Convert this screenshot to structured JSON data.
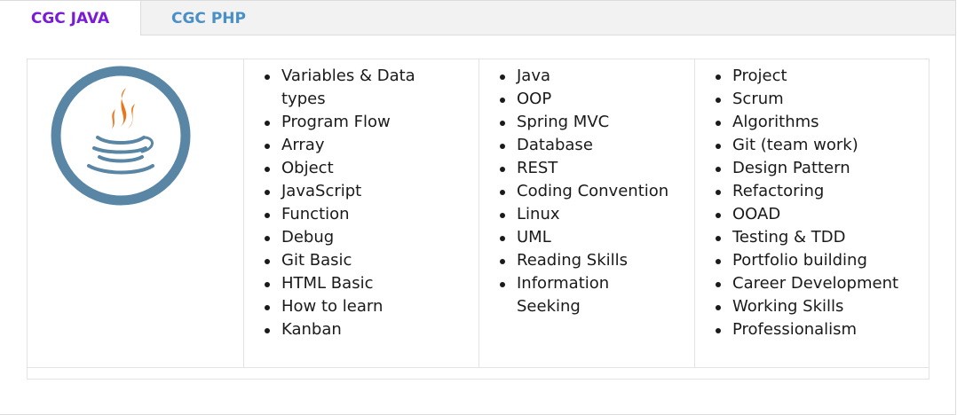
{
  "tabs": [
    {
      "label": "CGC JAVA",
      "active": true,
      "color": "#7a1bd6"
    },
    {
      "label": "CGC PHP",
      "active": false,
      "color": "#4a90c6"
    }
  ],
  "logo": {
    "icon": "java-logo-icon",
    "ring_color": "#5a86a6",
    "flame_color": "#e8761b",
    "cup_color": "#5a86a6"
  },
  "columns": [
    {
      "items": [
        "Variables & Data types",
        "Program Flow",
        "Array",
        "Object",
        "JavaScript",
        "Function",
        "Debug",
        "Git Basic",
        "HTML Basic",
        "How to learn",
        "Kanban"
      ]
    },
    {
      "items": [
        "Java",
        "OOP",
        "Spring MVC",
        "Database",
        "REST",
        "Coding Convention",
        "Linux",
        "UML",
        "Reading Skills",
        "Information Seeking"
      ]
    },
    {
      "items": [
        "Project",
        "Scrum",
        "Algorithms",
        "Git (team work)",
        "Design Pattern",
        "Refactoring",
        "OOAD",
        "Testing & TDD",
        "Portfolio building",
        "Career Development",
        "Working Skills",
        "Professionalism"
      ]
    }
  ]
}
